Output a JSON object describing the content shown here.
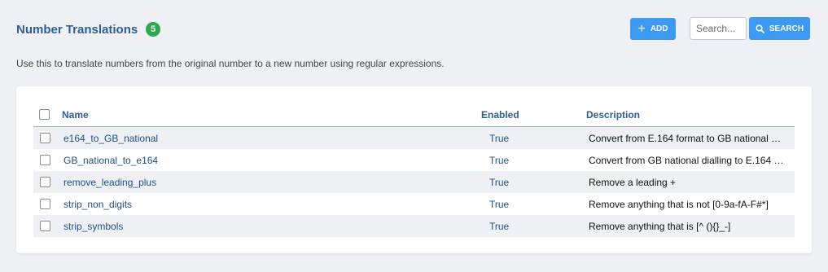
{
  "header": {
    "title": "Number Translations",
    "count": "5",
    "add_label": "ADD",
    "search_placeholder": "Search...",
    "search_label": "SEARCH"
  },
  "description": "Use this to translate numbers from the original number to a new number using regular expressions.",
  "table": {
    "columns": {
      "name": "Name",
      "enabled": "Enabled",
      "description": "Description"
    },
    "rows": [
      {
        "name": "e164_to_GB_national",
        "enabled": "True",
        "description": "Convert from E.164 format to GB national …"
      },
      {
        "name": "GB_national_to_e164",
        "enabled": "True",
        "description": "Convert from GB national dialling to E.164 …"
      },
      {
        "name": "remove_leading_plus",
        "enabled": "True",
        "description": "Remove a leading +"
      },
      {
        "name": "strip_non_digits",
        "enabled": "True",
        "description": "Remove anything that is not [0-9a-fA-F#*]"
      },
      {
        "name": "strip_symbols",
        "enabled": "True",
        "description": "Remove anything that is [^ (){}_-]"
      }
    ]
  },
  "colors": {
    "accent": "#3d9af2",
    "title": "#2c5f94",
    "badge": "#2fa84f"
  },
  "icons": {
    "add": "plus-icon",
    "search": "magnifier-icon"
  }
}
